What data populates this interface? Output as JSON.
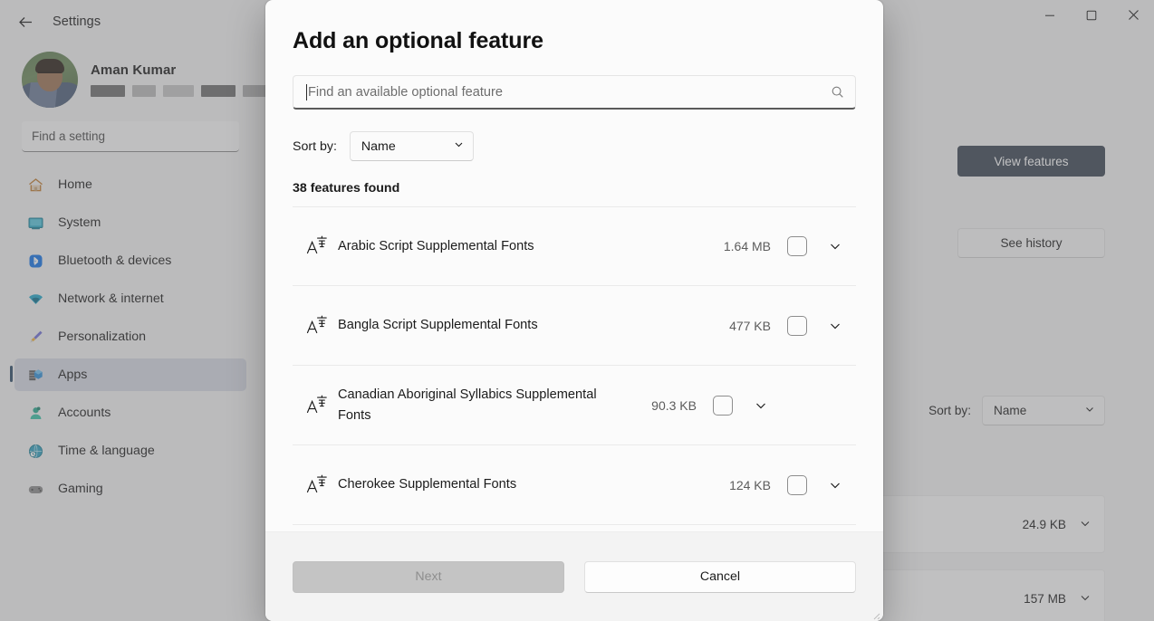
{
  "window": {
    "title": "Settings",
    "back_icon": "back-arrow-icon",
    "controls": {
      "minimize": "minimize-icon",
      "maximize": "maximize-icon",
      "close": "close-icon"
    }
  },
  "sidebar": {
    "account": {
      "name": "Aman Kumar",
      "avatar": "user-avatar"
    },
    "search": {
      "placeholder": "Find a setting"
    },
    "items": [
      {
        "label": "Home",
        "icon": "home-icon",
        "selected": false
      },
      {
        "label": "System",
        "icon": "system-icon",
        "selected": false
      },
      {
        "label": "Bluetooth & devices",
        "icon": "bluetooth-icon",
        "selected": false
      },
      {
        "label": "Network & internet",
        "icon": "network-icon",
        "selected": false
      },
      {
        "label": "Personalization",
        "icon": "brush-icon",
        "selected": false
      },
      {
        "label": "Apps",
        "icon": "apps-icon",
        "selected": true
      },
      {
        "label": "Accounts",
        "icon": "accounts-icon",
        "selected": false
      },
      {
        "label": "Time & language",
        "icon": "clock-icon",
        "selected": false
      },
      {
        "label": "Gaming",
        "icon": "gaming-icon",
        "selected": false
      }
    ]
  },
  "background_page": {
    "view_features_button": "View features",
    "see_history_button": "See history",
    "sort_label": "Sort by:",
    "sort_value": "Name",
    "rows": [
      {
        "size": "24.9 KB"
      },
      {
        "size": "157 MB"
      }
    ]
  },
  "dialog": {
    "title": "Add an optional feature",
    "search": {
      "placeholder": "Find an available optional feature",
      "value": "",
      "icon": "search-icon"
    },
    "sort": {
      "label": "Sort by:",
      "value": "Name",
      "icon": "chevron-down-icon"
    },
    "results_count": "38 features found",
    "features": [
      {
        "name": "Arabic Script Supplemental Fonts",
        "size": "1.64 MB",
        "icon": "font-icon",
        "checked": false
      },
      {
        "name": "Bangla Script Supplemental Fonts",
        "size": "477 KB",
        "icon": "font-icon",
        "checked": false
      },
      {
        "name": "Canadian Aboriginal Syllabics Supplemental Fonts",
        "size": "90.3 KB",
        "icon": "font-icon",
        "checked": false
      },
      {
        "name": "Cherokee Supplemental Fonts",
        "size": "124 KB",
        "icon": "font-icon",
        "checked": false
      }
    ],
    "footer": {
      "next_label": "Next",
      "next_disabled": true,
      "cancel_label": "Cancel"
    }
  },
  "colors": {
    "accent": "#2b4a66",
    "dialog_bg": "#fbfbfb",
    "footer_bg": "#f3f3f3",
    "primary_button_bg": "#3b4553",
    "disabled_button_bg": "#c4c4c4"
  }
}
